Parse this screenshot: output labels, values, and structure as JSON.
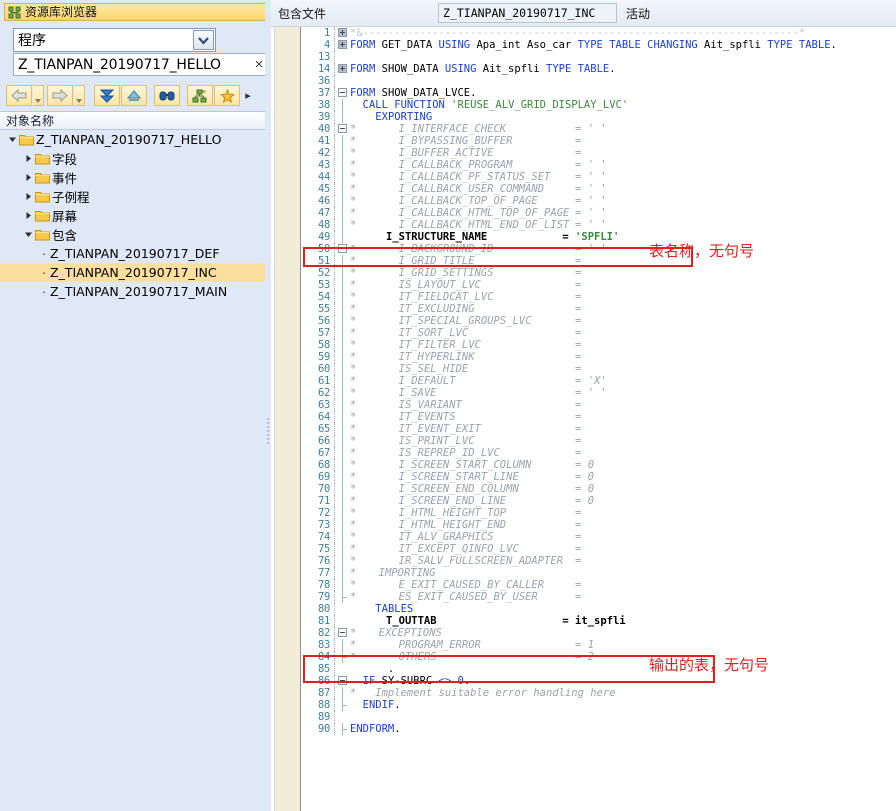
{
  "left_panel": {
    "title": "资源库浏览器",
    "title_icon": "repository-browser-icon",
    "combo": {
      "value": "程序",
      "icon": "chevron-down-icon"
    },
    "search": {
      "value": "Z_TIANPAN_20190717_HELLO",
      "placeholder": "",
      "clear_icon": "×"
    },
    "toolbar": [
      {
        "name": "back-button",
        "icon": "arrow-left-icon"
      },
      {
        "name": "back-dropdown",
        "icon": "triangle-down-icon"
      },
      {
        "name": "forward-button",
        "icon": "arrow-right-icon"
      },
      {
        "name": "forward-dropdown",
        "icon": "triangle-down-icon"
      },
      {
        "name": "expand-all-button",
        "icon": "double-chevron-down-icon"
      },
      {
        "name": "collapse-all-button",
        "icon": "chevron-up-icon"
      },
      {
        "name": "find-button",
        "icon": "binoculars-icon"
      },
      {
        "name": "add-to-hierarchy-button",
        "icon": "hierarchy-plus-icon"
      },
      {
        "name": "favorites-button",
        "icon": "star-icon"
      },
      {
        "name": "more-button",
        "icon": "triangle-right-icon"
      }
    ],
    "column_header": "对象名称",
    "tree": [
      {
        "label": "Z_TIANPAN_20190717_HELLO",
        "indent": 0,
        "type": "folder",
        "state": "expanded",
        "selected": false
      },
      {
        "label": "字段",
        "indent": 1,
        "type": "folder",
        "state": "collapsed",
        "selected": false
      },
      {
        "label": "事件",
        "indent": 1,
        "type": "folder",
        "state": "collapsed",
        "selected": false
      },
      {
        "label": "子例程",
        "indent": 1,
        "type": "folder",
        "state": "collapsed",
        "selected": false
      },
      {
        "label": "屏幕",
        "indent": 1,
        "type": "folder",
        "state": "collapsed",
        "selected": false
      },
      {
        "label": "包含",
        "indent": 1,
        "type": "folder",
        "state": "expanded",
        "selected": false
      },
      {
        "label": "Z_TIANPAN_20190717_DEF",
        "indent": 2,
        "type": "leaf",
        "state": "",
        "selected": false
      },
      {
        "label": "Z_TIANPAN_20190717_INC",
        "indent": 2,
        "type": "leaf",
        "state": "",
        "selected": true
      },
      {
        "label": "Z_TIANPAN_20190717_MAIN",
        "indent": 2,
        "type": "leaf",
        "state": "",
        "selected": false
      }
    ]
  },
  "editor_header": {
    "label": "包含文件",
    "object_name": "Z_TIANPAN_20190717_INC",
    "status": "活动"
  },
  "annotations": [
    {
      "name": "structure-name-note",
      "text": "表名称，无句号",
      "color": "#e02020"
    },
    {
      "name": "output-table-note",
      "text": "输出的表，无句号",
      "color": "#e02020"
    }
  ],
  "code": {
    "lines": [
      {
        "n": "1",
        "fold": "plus-gray",
        "kind": "collapsed-comment",
        "text": "*&---------------------------------------------------------------------*"
      },
      {
        "n": "4",
        "fold": "plus-gray",
        "kind": "code",
        "tokens": [
          [
            "kw",
            "FORM"
          ],
          [
            "plain",
            " GET_DATA "
          ],
          [
            "kw",
            "USING"
          ],
          [
            "plain",
            " Apa_int Aso_car "
          ],
          [
            "kw",
            "TYPE"
          ],
          [
            "plain",
            " "
          ],
          [
            "kw",
            "TABLE"
          ],
          [
            "plain",
            " "
          ],
          [
            "kw",
            "CHANGING"
          ],
          [
            "plain",
            " Ait_spfli "
          ],
          [
            "kw",
            "TYPE"
          ],
          [
            "plain",
            " "
          ],
          [
            "kw",
            "TABLE"
          ],
          [
            "plain",
            "."
          ]
        ]
      },
      {
        "n": "13",
        "fold": "",
        "kind": "blank",
        "tokens": []
      },
      {
        "n": "14",
        "fold": "plus-gray",
        "kind": "code",
        "tokens": [
          [
            "kw",
            "FORM"
          ],
          [
            "plain",
            " SHOW_DATA "
          ],
          [
            "kw",
            "USING"
          ],
          [
            "plain",
            " Ait_spfli "
          ],
          [
            "kw",
            "TYPE"
          ],
          [
            "plain",
            " "
          ],
          [
            "kw",
            "TABLE"
          ],
          [
            "plain",
            "."
          ]
        ]
      },
      {
        "n": "36",
        "fold": "",
        "kind": "blank",
        "tokens": []
      },
      {
        "n": "37",
        "fold": "minus",
        "kind": "code",
        "tokens": [
          [
            "kw",
            "FORM"
          ],
          [
            "plain",
            " SHOW_DATA_LVCE."
          ]
        ]
      },
      {
        "n": "38",
        "fold": "bar",
        "kind": "code",
        "tokens": [
          [
            "plain",
            "  "
          ],
          [
            "kw",
            "CALL FUNCTION"
          ],
          [
            "plain",
            " "
          ],
          [
            "str",
            "'REUSE_ALV_GRID_DISPLAY_LVC'"
          ]
        ]
      },
      {
        "n": "39",
        "fold": "bar",
        "kind": "code",
        "tokens": [
          [
            "plain",
            "    "
          ],
          [
            "kw",
            "EXPORTING"
          ]
        ]
      },
      {
        "n": "40",
        "fold": "minus",
        "kind": "comment",
        "star": true,
        "name": "I_INTERFACE_CHECK",
        "eq": "= ' '"
      },
      {
        "n": "41",
        "fold": "bar",
        "kind": "comment",
        "star": true,
        "name": "I_BYPASSING_BUFFER",
        "eq": "="
      },
      {
        "n": "42",
        "fold": "bar",
        "kind": "comment",
        "star": true,
        "name": "I_BUFFER_ACTIVE",
        "eq": "="
      },
      {
        "n": "43",
        "fold": "bar",
        "kind": "comment",
        "star": true,
        "name": "I_CALLBACK_PROGRAM",
        "eq": "= ' '"
      },
      {
        "n": "44",
        "fold": "bar",
        "kind": "comment",
        "star": true,
        "name": "I_CALLBACK_PF_STATUS_SET",
        "eq": "= ' '"
      },
      {
        "n": "45",
        "fold": "bar",
        "kind": "comment",
        "star": true,
        "name": "I_CALLBACK_USER_COMMAND",
        "eq": "= ' '"
      },
      {
        "n": "46",
        "fold": "bar",
        "kind": "comment",
        "star": true,
        "name": "I_CALLBACK_TOP_OF_PAGE",
        "eq": "= ' '"
      },
      {
        "n": "47",
        "fold": "bar",
        "kind": "comment",
        "star": true,
        "name": "I_CALLBACK_HTML_TOP_OF_PAGE",
        "eq": "= ' '"
      },
      {
        "n": "48",
        "fold": "bar",
        "kind": "comment",
        "star": true,
        "name": "I_CALLBACK_HTML_END_OF_LIST",
        "eq": "= ' '"
      },
      {
        "n": "49",
        "fold": "bar",
        "kind": "active",
        "name": "I_STRUCTURE_NAME",
        "eq": "= ",
        "val": "'SPFLI'"
      },
      {
        "n": "50",
        "fold": "minus",
        "kind": "comment",
        "star": true,
        "name": "I_BACKGROUND_ID",
        "eq": "= ' '"
      },
      {
        "n": "51",
        "fold": "bar",
        "kind": "comment",
        "star": true,
        "name": "I_GRID_TITLE",
        "eq": "="
      },
      {
        "n": "52",
        "fold": "bar",
        "kind": "comment",
        "star": true,
        "name": "I_GRID_SETTINGS",
        "eq": "="
      },
      {
        "n": "53",
        "fold": "bar",
        "kind": "comment",
        "star": true,
        "name": "IS_LAYOUT_LVC",
        "eq": "="
      },
      {
        "n": "54",
        "fold": "bar",
        "kind": "comment",
        "star": true,
        "name": "IT_FIELDCAT_LVC",
        "eq": "="
      },
      {
        "n": "55",
        "fold": "bar",
        "kind": "comment",
        "star": true,
        "name": "IT_EXCLUDING",
        "eq": "="
      },
      {
        "n": "56",
        "fold": "bar",
        "kind": "comment",
        "star": true,
        "name": "IT_SPECIAL_GROUPS_LVC",
        "eq": "="
      },
      {
        "n": "57",
        "fold": "bar",
        "kind": "comment",
        "star": true,
        "name": "IT_SORT_LVC",
        "eq": "="
      },
      {
        "n": "58",
        "fold": "bar",
        "kind": "comment",
        "star": true,
        "name": "IT_FILTER_LVC",
        "eq": "="
      },
      {
        "n": "59",
        "fold": "bar",
        "kind": "comment",
        "star": true,
        "name": "IT_HYPERLINK",
        "eq": "="
      },
      {
        "n": "60",
        "fold": "bar",
        "kind": "comment",
        "star": true,
        "name": "IS_SEL_HIDE",
        "eq": "="
      },
      {
        "n": "61",
        "fold": "bar",
        "kind": "comment",
        "star": true,
        "name": "I_DEFAULT",
        "eq": "= 'X'"
      },
      {
        "n": "62",
        "fold": "bar",
        "kind": "comment",
        "star": true,
        "name": "I_SAVE",
        "eq": "= ' '"
      },
      {
        "n": "63",
        "fold": "bar",
        "kind": "comment",
        "star": true,
        "name": "IS_VARIANT",
        "eq": "="
      },
      {
        "n": "64",
        "fold": "bar",
        "kind": "comment",
        "star": true,
        "name": "IT_EVENTS",
        "eq": "="
      },
      {
        "n": "65",
        "fold": "bar",
        "kind": "comment",
        "star": true,
        "name": "IT_EVENT_EXIT",
        "eq": "="
      },
      {
        "n": "66",
        "fold": "bar",
        "kind": "comment",
        "star": true,
        "name": "IS_PRINT_LVC",
        "eq": "="
      },
      {
        "n": "67",
        "fold": "bar",
        "kind": "comment",
        "star": true,
        "name": "IS_REPREP_ID_LVC",
        "eq": "="
      },
      {
        "n": "68",
        "fold": "bar",
        "kind": "comment",
        "star": true,
        "name": "I_SCREEN_START_COLUMN",
        "eq": "= 0"
      },
      {
        "n": "69",
        "fold": "bar",
        "kind": "comment",
        "star": true,
        "name": "I_SCREEN_START_LINE",
        "eq": "= 0"
      },
      {
        "n": "70",
        "fold": "bar",
        "kind": "comment",
        "star": true,
        "name": "I_SCREEN_END_COLUMN",
        "eq": "= 0"
      },
      {
        "n": "71",
        "fold": "bar",
        "kind": "comment",
        "star": true,
        "name": "I_SCREEN_END_LINE",
        "eq": "= 0"
      },
      {
        "n": "72",
        "fold": "bar",
        "kind": "comment",
        "star": true,
        "name": "I_HTML_HEIGHT_TOP",
        "eq": "="
      },
      {
        "n": "73",
        "fold": "bar",
        "kind": "comment",
        "star": true,
        "name": "I_HTML_HEIGHT_END",
        "eq": "="
      },
      {
        "n": "74",
        "fold": "bar",
        "kind": "comment",
        "star": true,
        "name": "IT_ALV_GRAPHICS",
        "eq": "="
      },
      {
        "n": "75",
        "fold": "bar",
        "kind": "comment",
        "star": true,
        "name": "IT_EXCEPT_QINFO_LVC",
        "eq": "="
      },
      {
        "n": "76",
        "fold": "bar",
        "kind": "comment",
        "star": true,
        "name": "IR_SALV_FULLSCREEN_ADAPTER",
        "eq": "="
      },
      {
        "n": "77",
        "fold": "bar",
        "kind": "comment-head",
        "star": true,
        "name": "IMPORTING",
        "eq": ""
      },
      {
        "n": "78",
        "fold": "bar",
        "kind": "comment",
        "star": true,
        "name": "E_EXIT_CAUSED_BY_CALLER",
        "eq": "="
      },
      {
        "n": "79",
        "fold": "tick",
        "kind": "comment",
        "star": true,
        "name": "ES_EXIT_CAUSED_BY_USER",
        "eq": "="
      },
      {
        "n": "80",
        "fold": "",
        "kind": "code",
        "tokens": [
          [
            "plain",
            "    "
          ],
          [
            "kw",
            "TABLES"
          ]
        ]
      },
      {
        "n": "81",
        "fold": "",
        "kind": "active",
        "name": "T_OUTTAB",
        "eq": "= ",
        "val": "it_spfli",
        "valplain": true
      },
      {
        "n": "82",
        "fold": "minus",
        "kind": "comment-head",
        "star": true,
        "name": "EXCEPTIONS",
        "eq": ""
      },
      {
        "n": "83",
        "fold": "bar",
        "kind": "comment",
        "star": true,
        "name": "PROGRAM_ERROR",
        "eq": "= 1"
      },
      {
        "n": "84",
        "fold": "tick",
        "kind": "comment",
        "star": true,
        "name": "OTHERS",
        "eq": "= 2"
      },
      {
        "n": "85",
        "fold": "",
        "kind": "dot",
        "tokens": [
          [
            "plain",
            "      ."
          ]
        ]
      },
      {
        "n": "86",
        "fold": "minus",
        "kind": "code",
        "tokens": [
          [
            "plain",
            "  "
          ],
          [
            "kw",
            "IF"
          ],
          [
            "plain",
            " SY-SUBRC "
          ],
          [
            "kw",
            "<>"
          ],
          [
            "plain",
            " "
          ],
          [
            "kw",
            "0"
          ],
          [
            "plain",
            "."
          ]
        ]
      },
      {
        "n": "87",
        "fold": "bar",
        "kind": "code-comment",
        "tokens": [
          [
            "cmt",
            "*   Implement suitable error handling here"
          ]
        ]
      },
      {
        "n": "88",
        "fold": "tick",
        "kind": "code",
        "tokens": [
          [
            "plain",
            "  "
          ],
          [
            "kw",
            "ENDIF"
          ],
          [
            "plain",
            "."
          ]
        ]
      },
      {
        "n": "89",
        "fold": "",
        "kind": "blank",
        "tokens": []
      },
      {
        "n": "90",
        "fold": "end",
        "kind": "code",
        "tokens": [
          [
            "kw",
            "ENDFORM"
          ],
          [
            "plain",
            "."
          ]
        ]
      }
    ]
  }
}
